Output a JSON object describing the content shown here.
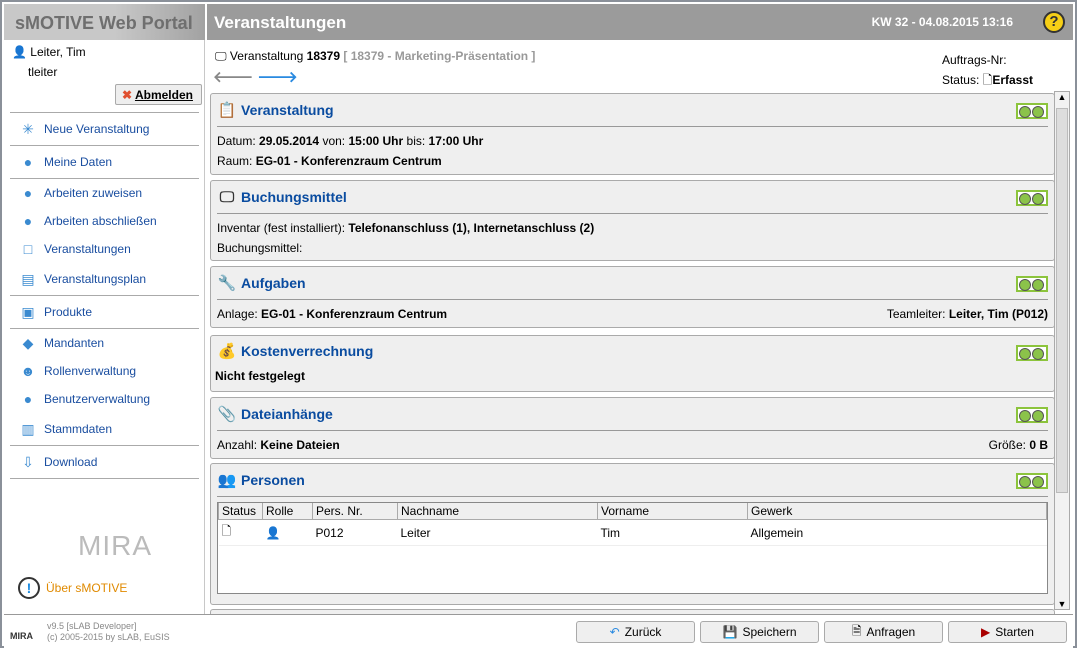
{
  "header": {
    "app_title": "sMOTIVE Web Portal",
    "page_title": "Veranstaltungen",
    "datetime": "KW 32 - 04.08.2015 13:16",
    "help": "?"
  },
  "user": {
    "name": "Leiter, Tim",
    "login": "tleiter",
    "logout": "Abmelden"
  },
  "nav": [
    {
      "label": "Neue Veranstaltung",
      "icon": "new-event-icon",
      "glyph": "✳",
      "sep": true
    },
    {
      "label": "Meine Daten",
      "icon": "user-data-icon",
      "glyph": "●",
      "sep": true
    },
    {
      "label": "Arbeiten zuweisen",
      "icon": "assign-work-icon",
      "glyph": "●",
      "sep": false
    },
    {
      "label": "Arbeiten abschließen",
      "icon": "complete-work-icon",
      "glyph": "●",
      "sep": false
    },
    {
      "label": "Veranstaltungen",
      "icon": "presentation-icon",
      "glyph": "□",
      "sep": false
    },
    {
      "label": "Veranstaltungsplan",
      "icon": "schedule-icon",
      "glyph": "▤",
      "sep": true
    },
    {
      "label": "Produkte",
      "icon": "products-icon",
      "glyph": "▣",
      "sep": true
    },
    {
      "label": "Mandanten",
      "icon": "clients-icon",
      "glyph": "◆",
      "sep": false
    },
    {
      "label": "Rollenverwaltung",
      "icon": "roles-icon",
      "glyph": "☻",
      "sep": false
    },
    {
      "label": "Benutzerverwaltung",
      "icon": "users-icon",
      "glyph": "●",
      "sep": false
    },
    {
      "label": "Stammdaten",
      "icon": "master-data-icon",
      "glyph": "▥",
      "sep": true
    },
    {
      "label": "Download",
      "icon": "download-icon",
      "glyph": "⇩",
      "sep": true
    }
  ],
  "sidebar": {
    "logo": "MIRA",
    "about": "Über sMOTIVE"
  },
  "footer": {
    "version": "v9.5 [sLAB Developer]",
    "copyright": "(c) 2005-2015 by sLAB, EuSIS",
    "logo": "MIRA",
    "buttons": {
      "back": "Zurück",
      "save": "Speichern",
      "request": "Anfragen",
      "start": "Starten"
    }
  },
  "record": {
    "type": "Veranstaltung",
    "id": "18379",
    "desc": "[ 18379 - Marketing-Präsentation ]",
    "auftrag_label": "Auftrags-Nr:",
    "status_label": "Status:",
    "status": "Erfasst"
  },
  "sections": {
    "veranstaltung": {
      "title": "Veranstaltung",
      "datum_l": "Datum:",
      "datum": "29.05.2014",
      "von_l": "von:",
      "von": "15:00 Uhr",
      "bis_l": "bis:",
      "bis": "17:00 Uhr",
      "raum_l": "Raum:",
      "raum": "EG-01 - Konferenzraum Centrum"
    },
    "buchungsmittel": {
      "title": "Buchungsmittel",
      "inv_l": "Inventar (fest installiert):",
      "inv": "Telefonanschluss (1), Internetanschluss (2)",
      "bm_l": "Buchungsmittel:"
    },
    "aufgaben": {
      "title": "Aufgaben",
      "anlage_l": "Anlage:",
      "anlage": "EG-01 - Konferenzraum Centrum",
      "tl_l": "Teamleiter:",
      "tl": "Leiter, Tim (P012)"
    },
    "kosten": {
      "title": "Kostenverrechnung",
      "text": "Nicht festgelegt"
    },
    "dateien": {
      "title": "Dateianhänge",
      "anzahl_l": "Anzahl:",
      "anzahl": "Keine Dateien",
      "groesse_l": "Größe:",
      "groesse": "0 B"
    },
    "personen": {
      "title": "Personen",
      "columns": [
        "Status",
        "Rolle",
        "Pers. Nr.",
        "Nachname",
        "Vorname",
        "Gewerk"
      ],
      "rows": [
        {
          "pers_nr": "P012",
          "nachname": "Leiter",
          "vorname": "Tim",
          "gewerk": "Allgemein"
        }
      ]
    }
  },
  "colors": {
    "link": "#1a4ea0",
    "section_title": "#0a4ca0",
    "status_light": "#8bc34a",
    "about": "#e08a00"
  }
}
